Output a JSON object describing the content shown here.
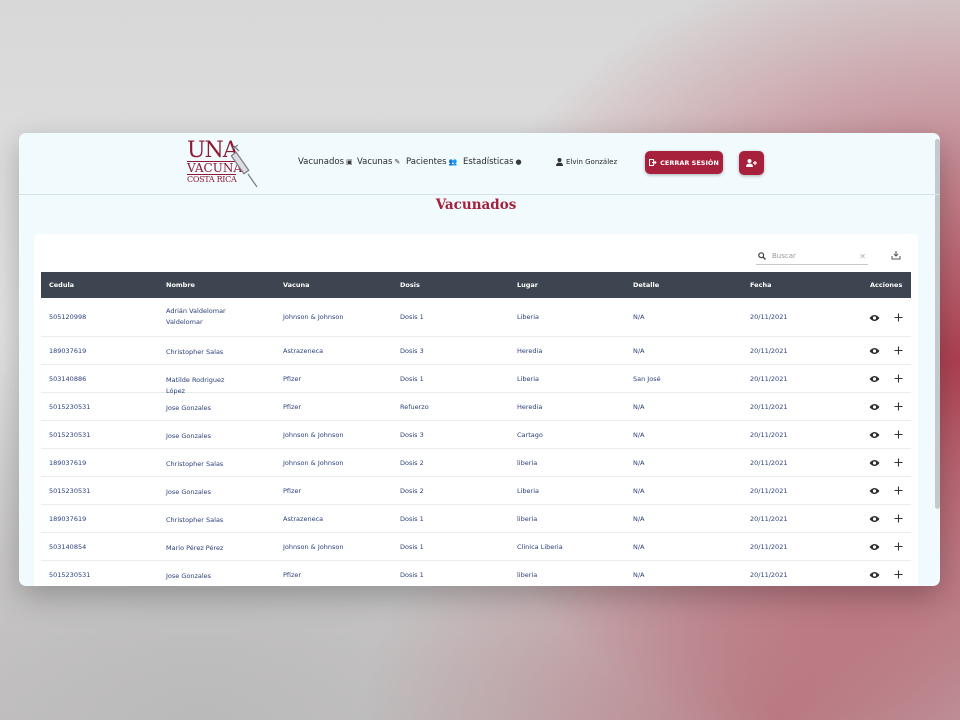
{
  "nav": {
    "logo_text": [
      "UNA",
      "VACUNA",
      "COSTA RICA"
    ],
    "links": [
      {
        "label": "Vacunados",
        "icon": "syringe-box-icon"
      },
      {
        "label": "Vacunas",
        "icon": "pencil-icon"
      },
      {
        "label": "Pacientes",
        "icon": "users-icon"
      },
      {
        "label": "Estadísticas",
        "icon": "globe-icon"
      }
    ],
    "user_name": "Elvin González",
    "logout_label": "CERRAR SESIÓN",
    "add_user_icon": "user-plus-icon"
  },
  "page_title": "Vacunados",
  "search": {
    "placeholder": "Buscar"
  },
  "colors": {
    "accent": "#a8213c",
    "header_bg": "#3d4550",
    "link": "#2a3f7a"
  },
  "table": {
    "columns": [
      "Cedula",
      "Nombre",
      "Vacuna",
      "Dosis",
      "Lugar",
      "Detalle",
      "Fecha",
      "Acciones"
    ],
    "rows": [
      {
        "cedula": "505120998",
        "nombre": "Adrián Valdelomar Valdelomar",
        "vacuna": "Johnson & Johnson",
        "dosis": "Dosis 1",
        "lugar": "Liberia",
        "detalle": "N/A",
        "fecha": "20/11/2021"
      },
      {
        "cedula": "189037619",
        "nombre": "Christopher Salas",
        "vacuna": "Astrazeneca",
        "dosis": "Dosis 3",
        "lugar": "Heredia",
        "detalle": "N/A",
        "fecha": "20/11/2021"
      },
      {
        "cedula": "503140886",
        "nombre": "Matilde Rodriguez López",
        "vacuna": "Pfizer",
        "dosis": "Dosis 1",
        "lugar": "Liberia",
        "detalle": "San José",
        "fecha": "20/11/2021"
      },
      {
        "cedula": "5015230531",
        "nombre": "Jose Gonzales",
        "vacuna": "Pfizer",
        "dosis": "Refuerzo",
        "lugar": "Heredia",
        "detalle": "N/A",
        "fecha": "20/11/2021"
      },
      {
        "cedula": "5015230531",
        "nombre": "Jose Gonzales",
        "vacuna": "Johnson & Johnson",
        "dosis": "Dosis 3",
        "lugar": "Cartago",
        "detalle": "N/A",
        "fecha": "20/11/2021"
      },
      {
        "cedula": "189037619",
        "nombre": "Christopher Salas",
        "vacuna": "Johnson & Johnson",
        "dosis": "Dosis 2",
        "lugar": "liberia",
        "detalle": "N/A",
        "fecha": "20/11/2021"
      },
      {
        "cedula": "5015230531",
        "nombre": "Jose Gonzales",
        "vacuna": "Pfizer",
        "dosis": "Dosis 2",
        "lugar": "Liberia",
        "detalle": "N/A",
        "fecha": "20/11/2021"
      },
      {
        "cedula": "189037619",
        "nombre": "Christopher Salas",
        "vacuna": "Astrazeneca",
        "dosis": "Dosis 1",
        "lugar": "liberia",
        "detalle": "N/A",
        "fecha": "20/11/2021"
      },
      {
        "cedula": "503140854",
        "nombre": "Mario Pérez Pérez",
        "vacuna": "Johnson & Johnson",
        "dosis": "Dosis 1",
        "lugar": "Clinica Liberia",
        "detalle": "N/A",
        "fecha": "20/11/2021"
      },
      {
        "cedula": "5015230531",
        "nombre": "Jose Gonzales",
        "vacuna": "Pfizer",
        "dosis": "Dosis 1",
        "lugar": "liberia",
        "detalle": "N/A",
        "fecha": "20/11/2021"
      }
    ]
  }
}
